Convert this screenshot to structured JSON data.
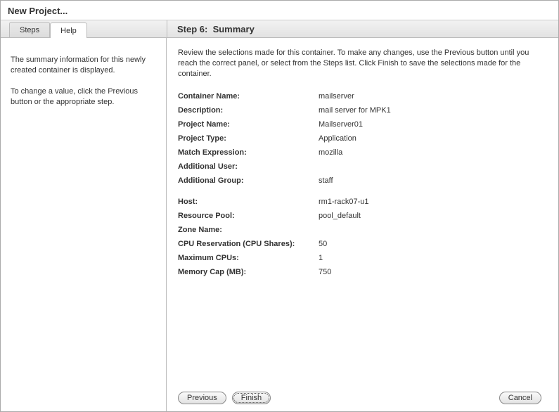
{
  "window_title": "New Project...",
  "tabs": {
    "steps": "Steps",
    "help": "Help"
  },
  "step_title": "Step 6:  Summary",
  "help_text": {
    "p1": "The summary information for this newly created container is displayed.",
    "p2": "To change a value, click the Previous button or the appropriate step."
  },
  "intro": "Review the selections made for this container. To make any changes, use the Previous button until you reach the correct panel, or select from the Steps list. Click Finish to save the selections made for the container.",
  "fields": {
    "container_name": {
      "label": "Container Name:",
      "value": "mailserver"
    },
    "description": {
      "label": "Description:",
      "value": "mail server for MPK1"
    },
    "project_name": {
      "label": "Project Name:",
      "value": "Mailserver01"
    },
    "project_type": {
      "label": "Project Type:",
      "value": "Application"
    },
    "match_expression": {
      "label": "Match Expression:",
      "value": "mozilla"
    },
    "additional_user": {
      "label": "Additional User:",
      "value": ""
    },
    "additional_group": {
      "label": "Additional Group:",
      "value": "staff"
    },
    "host": {
      "label": "Host:",
      "value": "rm1-rack07-u1"
    },
    "resource_pool": {
      "label": "Resource Pool:",
      "value": "pool_default"
    },
    "zone_name": {
      "label": "Zone Name:",
      "value": ""
    },
    "cpu_reservation": {
      "label": "CPU Reservation (CPU Shares):",
      "value": "50"
    },
    "maximum_cpus": {
      "label": "Maximum CPUs:",
      "value": "1"
    },
    "memory_cap": {
      "label": "Memory Cap (MB):",
      "value": "750"
    }
  },
  "buttons": {
    "previous": "Previous",
    "finish": "Finish",
    "cancel": "Cancel"
  }
}
